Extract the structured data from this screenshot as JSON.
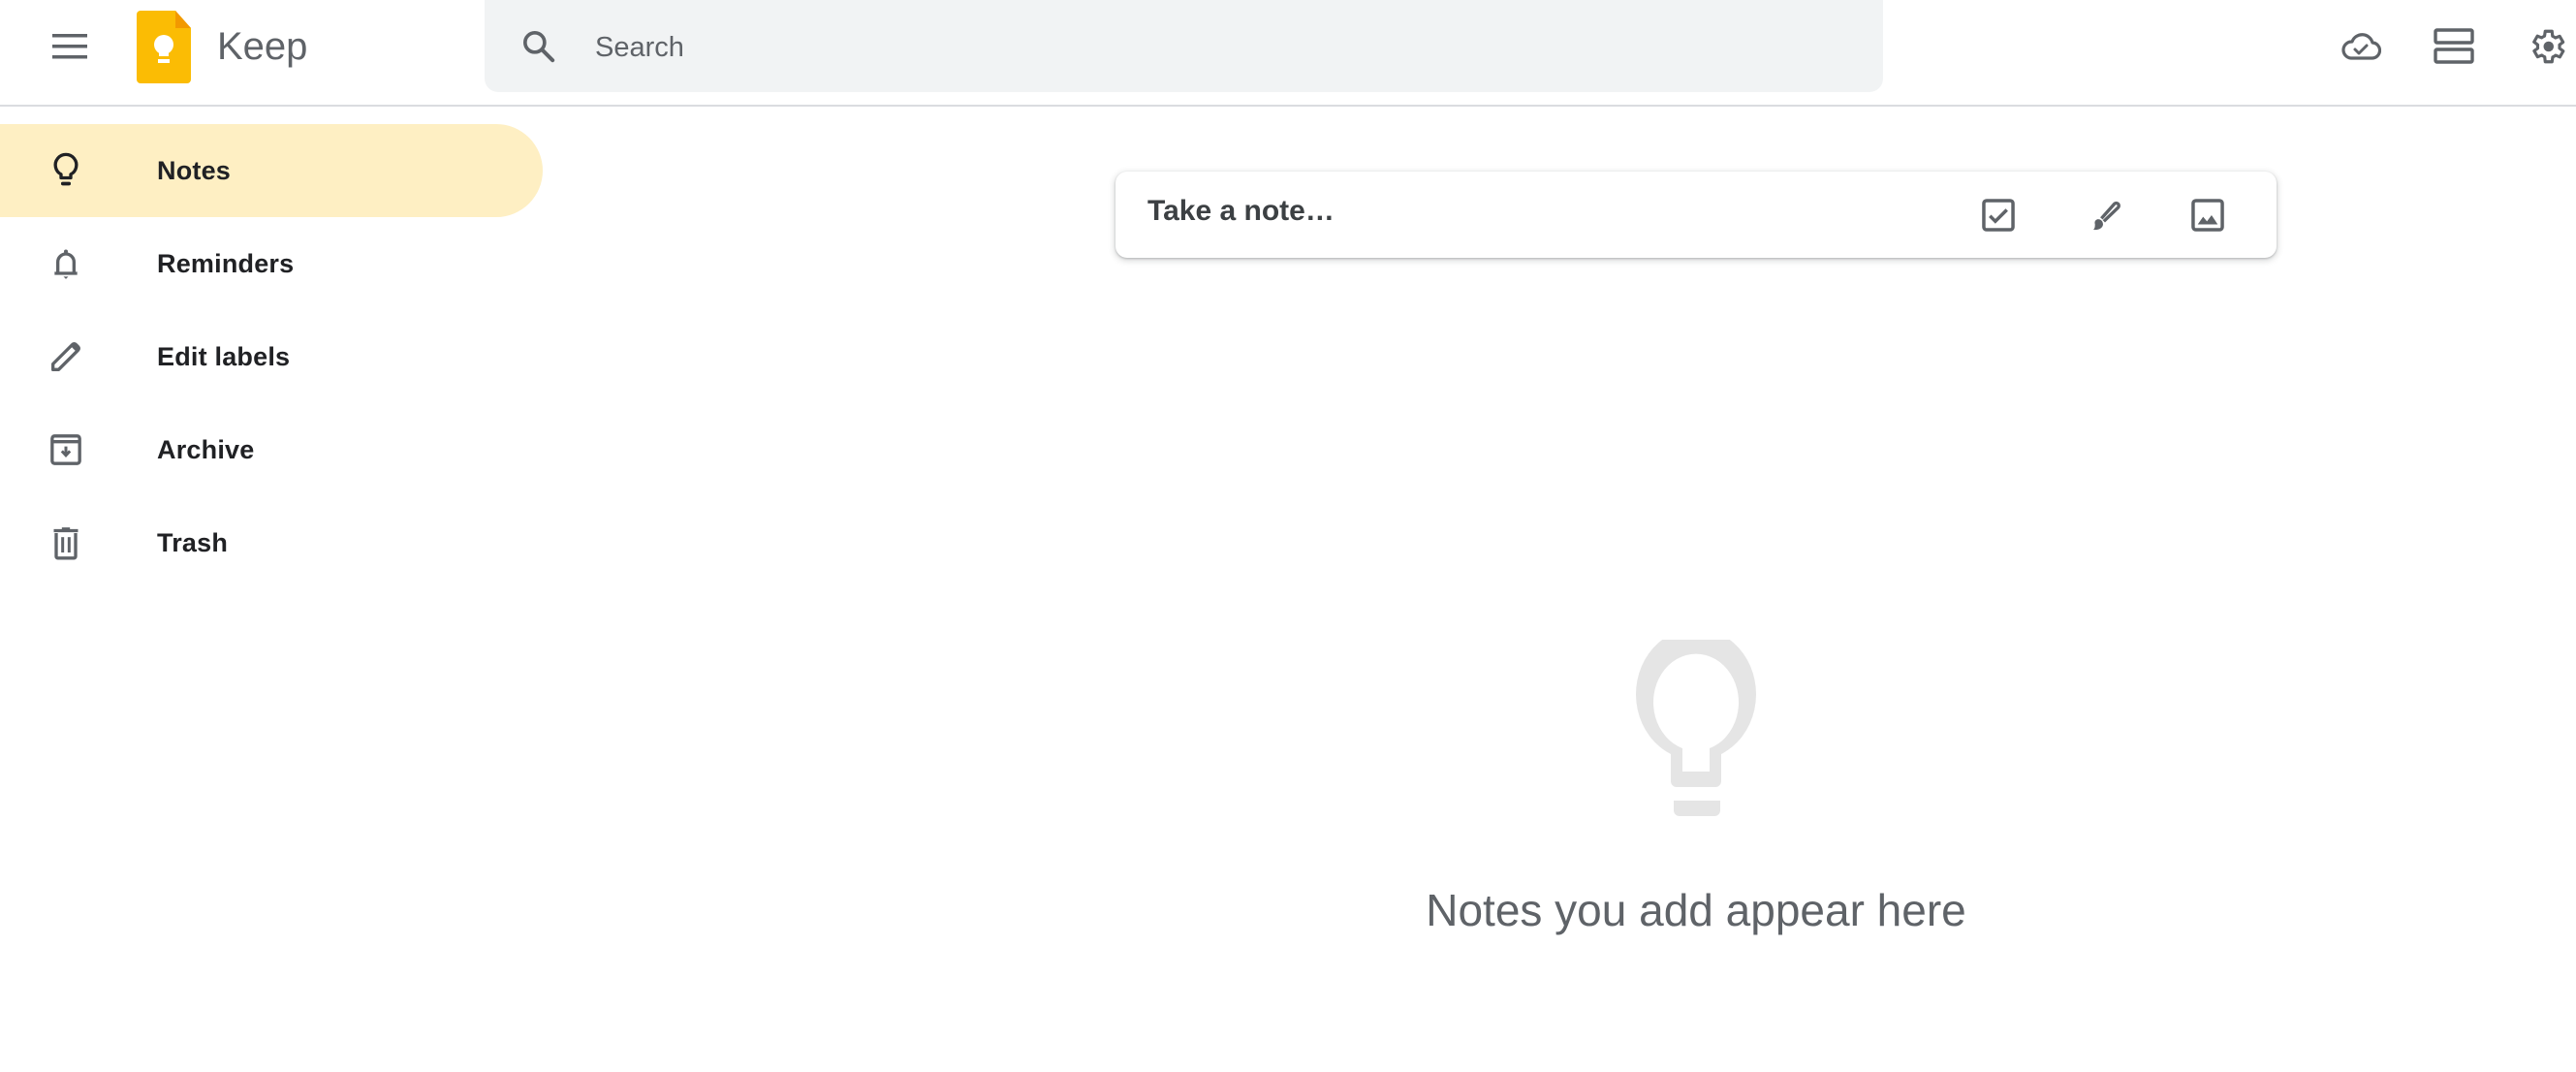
{
  "header": {
    "menu_icon": "hamburger-menu-icon",
    "logo_icon": "keep-logo-icon",
    "app_title": "Keep",
    "search": {
      "placeholder": "Search",
      "value": "",
      "icon": "search-icon"
    },
    "actions": [
      {
        "name": "refresh-sync",
        "icon": "cloud-check-icon"
      },
      {
        "name": "list-view-toggle",
        "icon": "view-list-icon"
      },
      {
        "name": "settings",
        "icon": "gear-icon"
      }
    ]
  },
  "sidebar": {
    "items": [
      {
        "label": "Notes",
        "icon": "lightbulb-icon",
        "active": true
      },
      {
        "label": "Reminders",
        "icon": "bell-icon",
        "active": false
      },
      {
        "label": "Edit labels",
        "icon": "pencil-icon",
        "active": false
      },
      {
        "label": "Archive",
        "icon": "archive-icon",
        "active": false
      },
      {
        "label": "Trash",
        "icon": "trash-icon",
        "active": false
      }
    ]
  },
  "note_input": {
    "placeholder": "Take a note…",
    "actions": [
      {
        "name": "new-list",
        "icon": "checkbox-icon"
      },
      {
        "name": "new-drawing",
        "icon": "brush-icon"
      },
      {
        "name": "new-image-note",
        "icon": "image-icon"
      }
    ]
  },
  "empty_state": {
    "icon": "lightbulb-icon",
    "message": "Notes you add appear here"
  },
  "colors": {
    "accent_yellow": "#FBBC04",
    "logo_fold": "#F29900",
    "active_nav_bg": "#FEEFC3",
    "search_bg": "#F1F3F4",
    "icon_gray": "#5F6368",
    "empty_icon": "#E5E5E5"
  }
}
